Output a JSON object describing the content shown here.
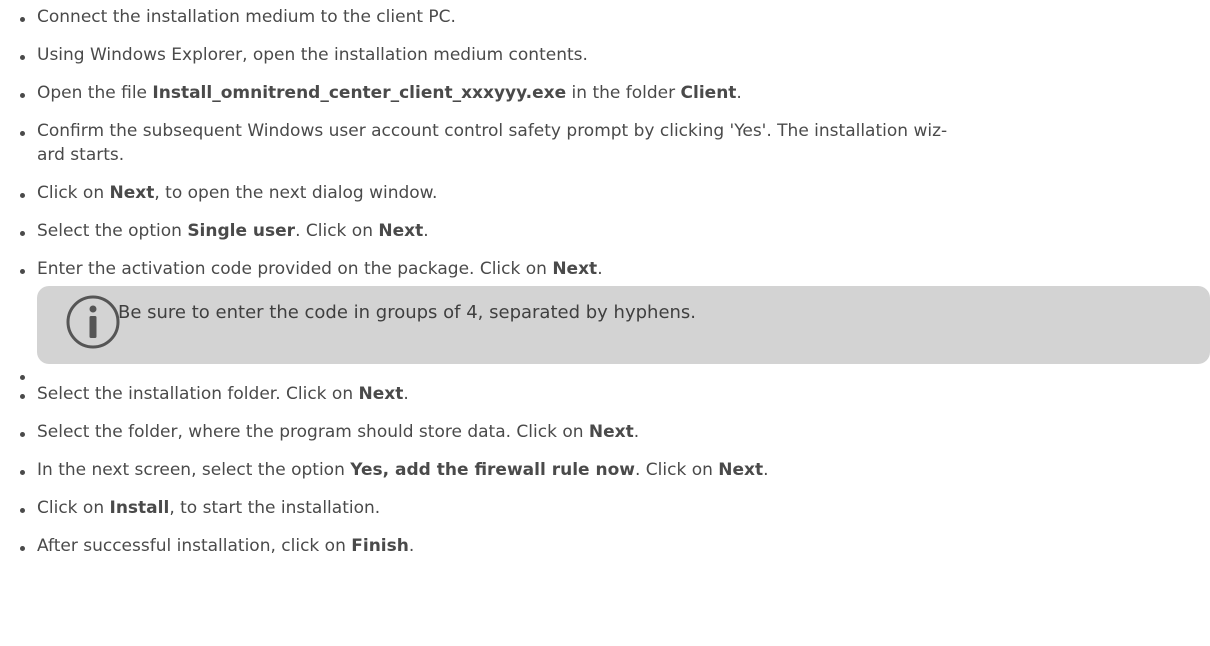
{
  "steps": [
    {
      "parts": [
        {
          "t": "Connect the installation medium to the client PC."
        }
      ]
    },
    {
      "parts": [
        {
          "t": "Using Windows Explorer, open the installation medium contents."
        }
      ]
    },
    {
      "parts": [
        {
          "t": "Open the file "
        },
        {
          "t": "Install_omnitrend_center_client_xxxyyy.exe",
          "b": true
        },
        {
          "t": " in the folder "
        },
        {
          "t": "Client",
          "b": true
        },
        {
          "t": "."
        }
      ]
    },
    {
      "parts": [
        {
          "t": "Confirm the subsequent Windows user account control safety prompt by clicking 'Yes'. The installation wiz-\nard starts."
        }
      ]
    },
    {
      "parts": [
        {
          "t": "Click on "
        },
        {
          "t": "Next",
          "b": true
        },
        {
          "t": ", to open the next dialog window."
        }
      ]
    },
    {
      "parts": [
        {
          "t": "Select the option "
        },
        {
          "t": "Single user",
          "b": true
        },
        {
          "t": ". Click on "
        },
        {
          "t": "Next",
          "b": true
        },
        {
          "t": "."
        }
      ]
    },
    {
      "parts": [
        {
          "t": "Enter the activation code provided on the package. Click on "
        },
        {
          "t": "Next",
          "b": true
        },
        {
          "t": "."
        }
      ]
    },
    {
      "note": true,
      "icon": "info-icon",
      "text": "Be sure to enter the code in groups of 4, separated by hyphens."
    },
    {
      "parts": [
        {
          "t": "Select the installation folder. Click on "
        },
        {
          "t": "Next",
          "b": true
        },
        {
          "t": "."
        }
      ]
    },
    {
      "parts": [
        {
          "t": "Select the folder, where the program should store data. Click on "
        },
        {
          "t": "Next",
          "b": true
        },
        {
          "t": "."
        }
      ]
    },
    {
      "parts": [
        {
          "t": "In the next screen, select the option "
        },
        {
          "t": "Yes, add the firewall rule now",
          "b": true
        },
        {
          "t": ". Click on "
        },
        {
          "t": "Next",
          "b": true
        },
        {
          "t": "."
        }
      ]
    },
    {
      "parts": [
        {
          "t": "Click on "
        },
        {
          "t": "Install",
          "b": true
        },
        {
          "t": ", to start the installation."
        }
      ]
    },
    {
      "parts": [
        {
          "t": "After successful installation, click on "
        },
        {
          "t": "Finish",
          "b": true
        },
        {
          "t": "."
        }
      ]
    }
  ],
  "colors": {
    "text": "#4a4a4a",
    "note_background": "#d3d3d3",
    "icon": "#555555"
  }
}
